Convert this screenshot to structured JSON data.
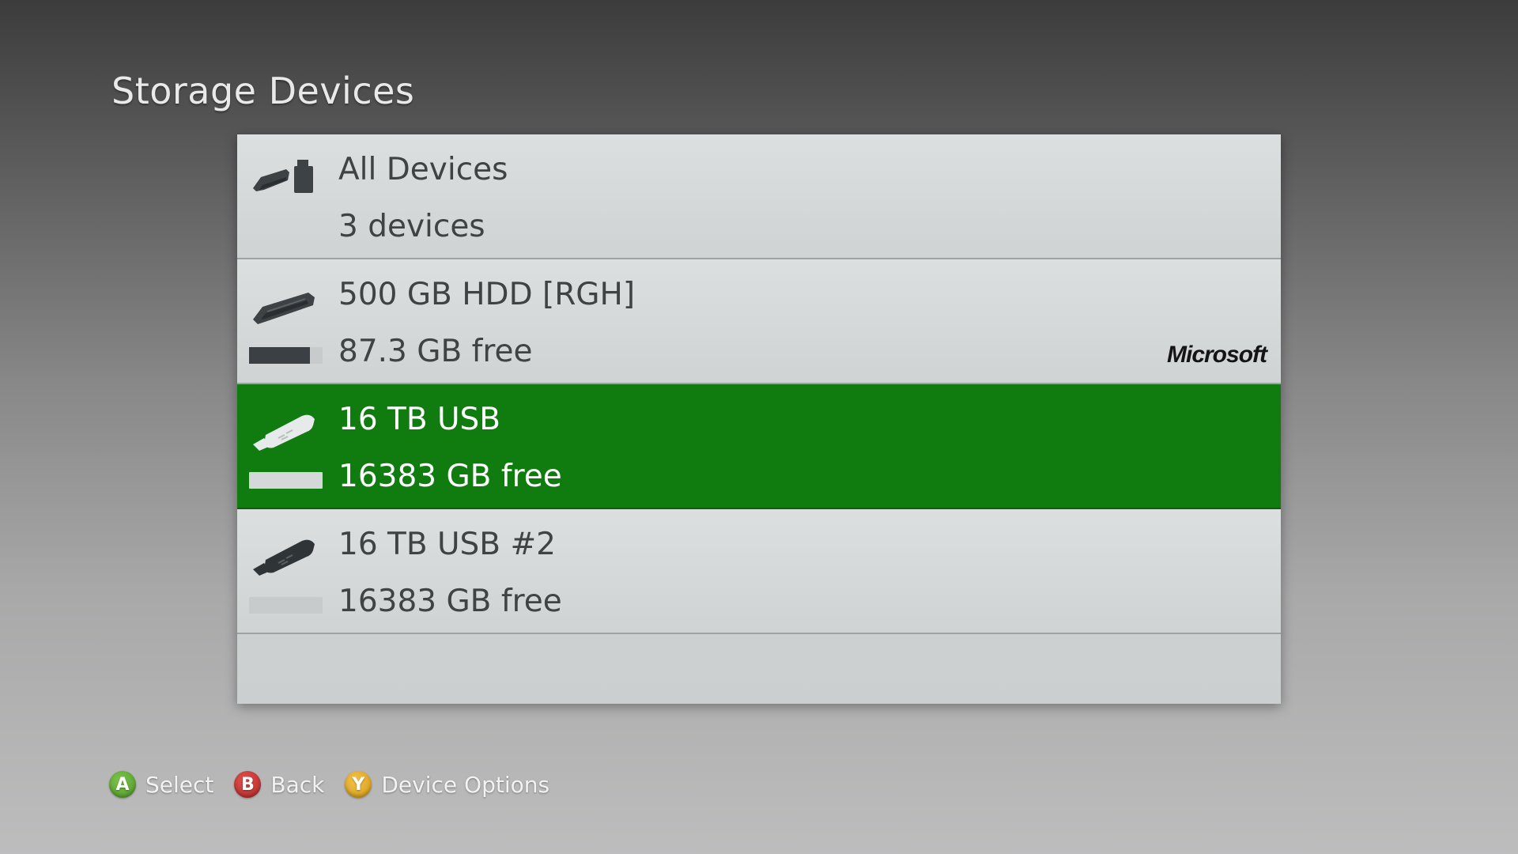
{
  "page": {
    "title": "Storage Devices"
  },
  "devices": [
    {
      "name": "All Devices",
      "subtitle": "3 devices",
      "icon": "all-devices-icon",
      "selected": false
    },
    {
      "name": "500 GB HDD [RGH]",
      "subtitle": "87.3 GB free",
      "icon": "hard-drive-icon",
      "usage_fraction": 0.83,
      "brand": "Microsoft",
      "selected": false
    },
    {
      "name": "16 TB USB",
      "subtitle": "16383 GB free",
      "icon": "usb-drive-icon",
      "usage_fraction": 0.0,
      "selected": true
    },
    {
      "name": "16 TB USB #2",
      "subtitle": "16383 GB free",
      "icon": "usb-drive-icon",
      "usage_fraction": 0.0,
      "selected": false
    }
  ],
  "footer": {
    "a": {
      "button": "A",
      "label": "Select",
      "color": "#5fab35"
    },
    "b": {
      "button": "B",
      "label": "Back",
      "color": "#c93634"
    },
    "y": {
      "button": "Y",
      "label": "Device Options",
      "color": "#e2ab26"
    }
  },
  "colors": {
    "selection": "#107c10",
    "list_background": "#d4d7d7",
    "row_text": "#3f4344"
  }
}
